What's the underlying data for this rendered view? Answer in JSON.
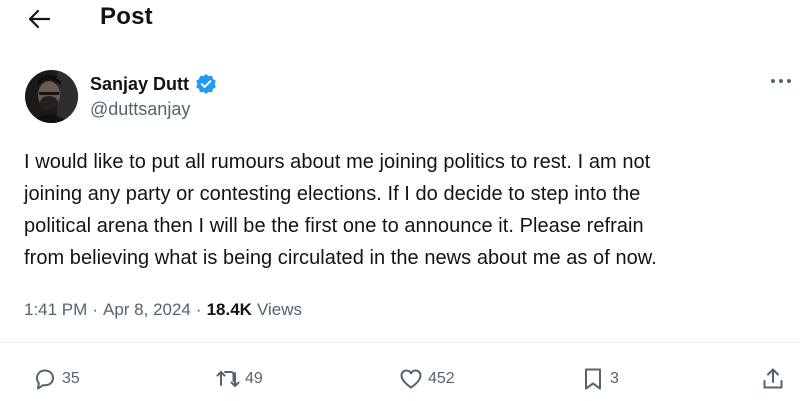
{
  "header": {
    "title": "Post",
    "back_icon": "arrow-left-icon"
  },
  "author": {
    "name": "Sanjay Dutt",
    "handle": "@duttsanjay",
    "verified": true,
    "verified_color": "#1d9bf0",
    "avatar_icon": "profile-photo"
  },
  "post": {
    "text": "I would like to put all rumours about me joining politics to rest. I am not\njoining any party or contesting elections. If I do decide to step into the\npolitical arena then I will be the first one to announce it.  Please refrain\nfrom believing what is being circulated in the news about me as of now."
  },
  "meta": {
    "time": "1:41 PM",
    "separator": "·",
    "date": "Apr 8, 2024",
    "views_count": "18.4K",
    "views_label": "Views"
  },
  "actions": {
    "replies": "35",
    "reposts": "49",
    "likes": "452",
    "bookmarks": "3"
  },
  "colors": {
    "text_primary": "#0f1419",
    "text_secondary": "#536471",
    "divider": "#eff3f4"
  }
}
